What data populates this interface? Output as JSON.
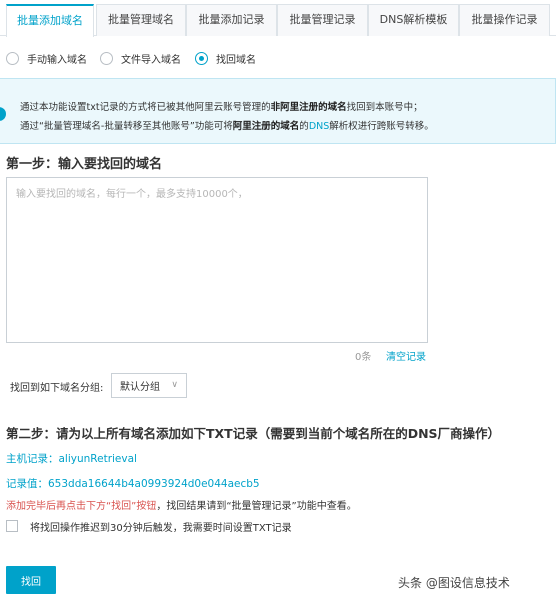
{
  "tabs": [
    {
      "label": "批量添加域名",
      "active": true
    },
    {
      "label": "批量管理域名",
      "active": false
    },
    {
      "label": "批量添加记录",
      "active": false
    },
    {
      "label": "批量管理记录",
      "active": false
    },
    {
      "label": "DNS解析模板",
      "active": false
    },
    {
      "label": "批量操作记录",
      "active": false
    }
  ],
  "mode_options": [
    {
      "label": "手动输入域名",
      "selected": false
    },
    {
      "label": "文件导入域名",
      "selected": false
    },
    {
      "label": "找回域名",
      "selected": true
    }
  ],
  "notice": {
    "line1": {
      "a": "通过本功能设置txt记录的方式将已被其他阿里云账号管理的",
      "b": "非阿里注册的域名",
      "c": "找回到本账号中；"
    },
    "line2": {
      "a": "通过“批量管理域名-批量转移至其他账号”功能可将",
      "b": "阿里注册的域名",
      "c": "的",
      "d": "DNS",
      "e": "解析权进行跨账号转移。"
    }
  },
  "step1": {
    "title": "第一步：输入要找回的域名",
    "placeholder": "输入要找回的域名，每行一个，最多支持10000个，",
    "count": "0条",
    "clear": "清空记录"
  },
  "group": {
    "label": "找回到如下域名分组:",
    "selected": "默认分组"
  },
  "step2": {
    "title": "第二步：请为以上所有域名添加如下TXT记录（需要到当前个域名所在的DNS厂商操作）",
    "host_label": "主机记录：aliyunRetrieval",
    "record_value": "记录值：653dda16644b4a0993924d0e044aecb5",
    "hint_warn": "添加完毕后再点击下方“找回”按钮",
    "hint_rest": "，找回结果请到“批量管理记录”功能中查看。"
  },
  "delay_option": {
    "label": "将找回操作推迟到30分钟后触发，我需要时间设置TXT记录",
    "checked": false
  },
  "submit_label": "找回",
  "watermark": "头条 @图设信息技术",
  "colors": {
    "accent": "#00a2ca",
    "warn": "#d9534f",
    "notice_bg": "#ebf8fc"
  }
}
